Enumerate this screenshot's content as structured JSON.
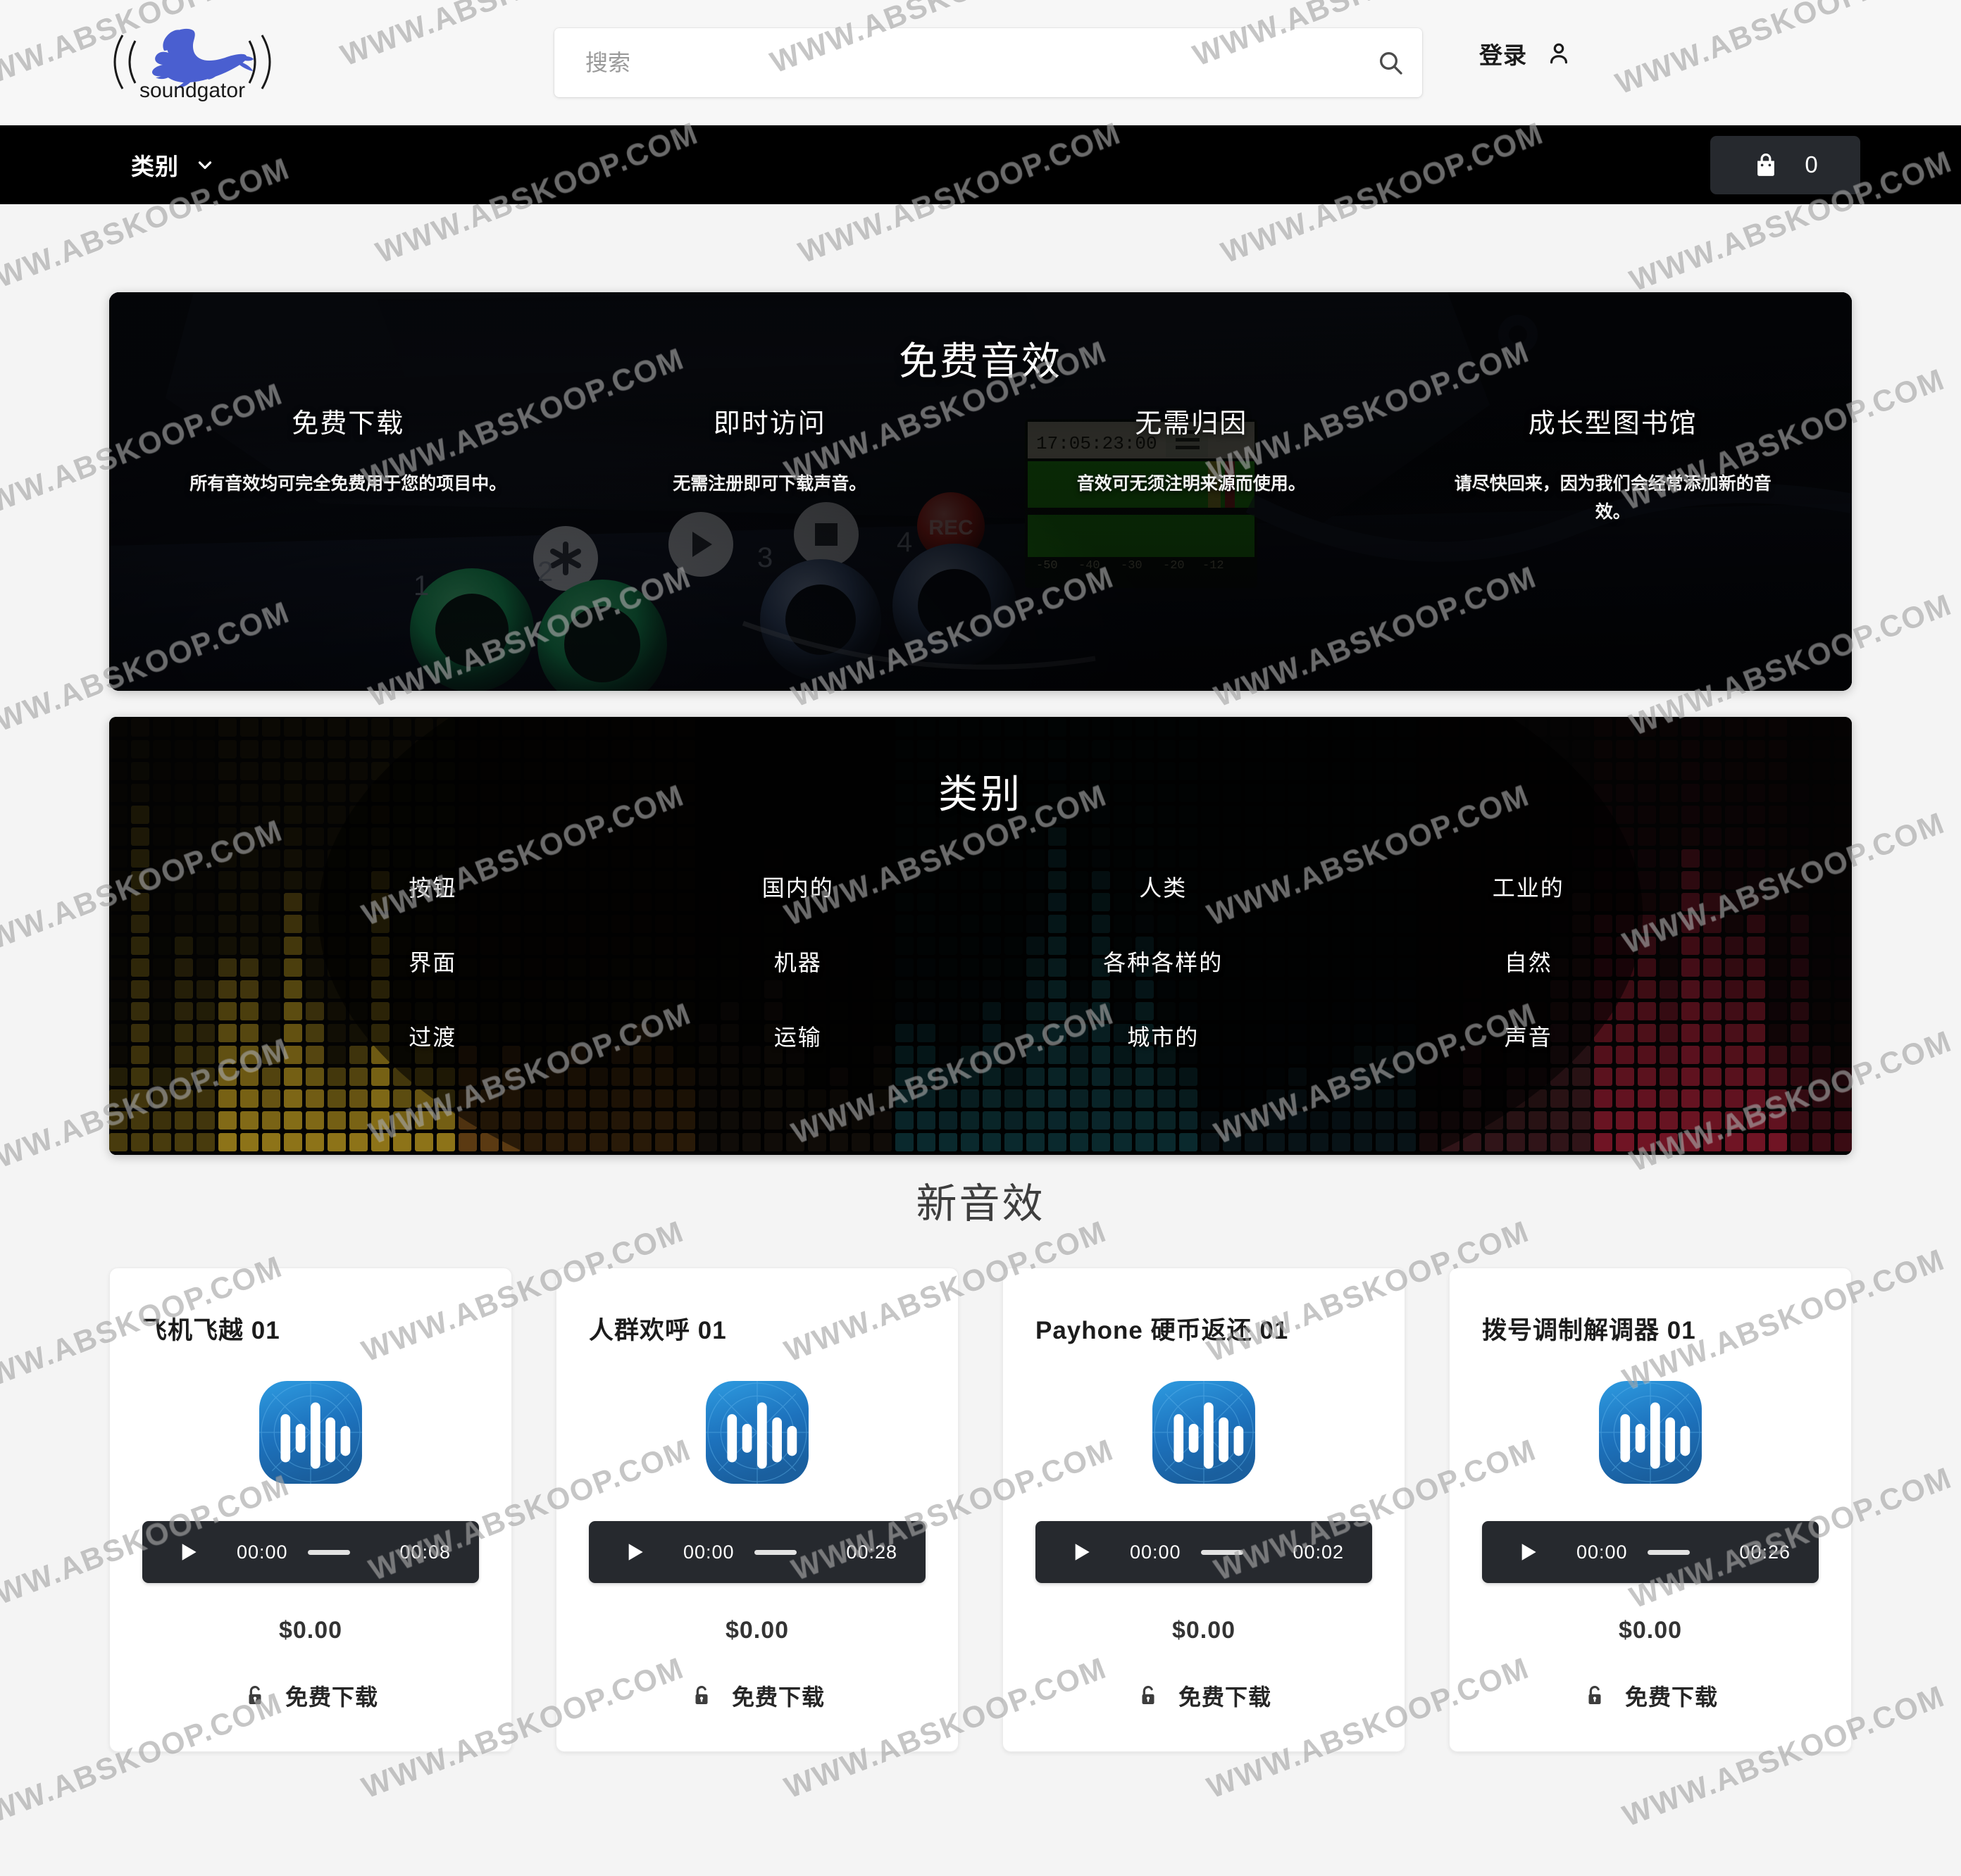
{
  "brand": {
    "name": "soundgator",
    "logo_color": "#4a5fd0"
  },
  "header": {
    "search": {
      "placeholder": "搜索",
      "value": "",
      "icon": "search-icon"
    },
    "login": {
      "label": "登录",
      "icon": "user-icon"
    }
  },
  "nav": {
    "categories_label": "类别",
    "chevron_icon": "chevron-down-icon",
    "cart": {
      "icon": "shopping-bag-icon",
      "count": "0"
    }
  },
  "hero": {
    "title": "免费音效",
    "features": [
      {
        "title": "免费下载",
        "desc": "所有音效均可完全免费用于您的项目中。"
      },
      {
        "title": "即时访问",
        "desc": "无需注册即可下载声音。"
      },
      {
        "title": "无需归因",
        "desc": "音效可无须注明来源而使用。"
      },
      {
        "title": "成长型图书馆",
        "desc": "请尽快回来，因为我们会经常添加新的音效。"
      }
    ]
  },
  "categories": {
    "title": "类别",
    "columns": [
      [
        "按钮",
        "界面",
        "过渡"
      ],
      [
        "国内的",
        "机器",
        "运输"
      ],
      [
        "人类",
        "各种各样的",
        "城市的"
      ],
      [
        "工业的",
        "自然",
        "声音"
      ]
    ]
  },
  "new_sounds": {
    "title": "新音效",
    "items": [
      {
        "title": "飞机飞越 01",
        "icon": "audio-waveform-icon",
        "player": {
          "play_icon": "play-icon",
          "current_time": "00:00",
          "duration": "00:08"
        },
        "price": "$0.00",
        "download": {
          "icon": "unlock-icon",
          "label": "免费下载"
        }
      },
      {
        "title": "人群欢呼 01",
        "icon": "audio-waveform-icon",
        "player": {
          "play_icon": "play-icon",
          "current_time": "00:00",
          "duration": "00:28"
        },
        "price": "$0.00",
        "download": {
          "icon": "unlock-icon",
          "label": "免费下载"
        }
      },
      {
        "title": "Payhone 硬币返还 01",
        "icon": "audio-waveform-icon",
        "player": {
          "play_icon": "play-icon",
          "current_time": "00:00",
          "duration": "00:02"
        },
        "price": "$0.00",
        "download": {
          "icon": "unlock-icon",
          "label": "免费下载"
        }
      },
      {
        "title": "拨号调制解调器 01",
        "icon": "audio-waveform-icon",
        "player": {
          "play_icon": "play-icon",
          "current_time": "00:00",
          "duration": "00:26"
        },
        "price": "$0.00",
        "download": {
          "icon": "unlock-icon",
          "label": "免费下载"
        }
      }
    ]
  },
  "watermark": {
    "text": "WWW.ABSKOOP.COM"
  },
  "colors": {
    "page_bg": "#f4f4f4",
    "nav_bg": "#000000",
    "player_bg": "#26292e",
    "icon_blue": "#1f7fd0",
    "card_bg": "#ffffff"
  }
}
